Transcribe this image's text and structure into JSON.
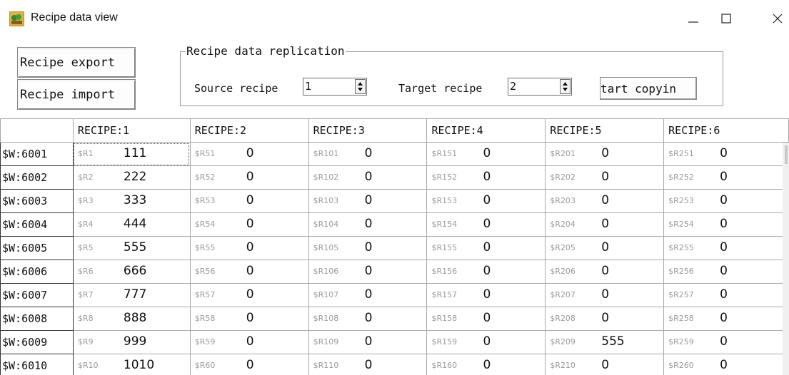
{
  "window": {
    "title": "Recipe data view",
    "minimize_glyph": "—",
    "maximize_glyph": "☐",
    "close_glyph": "✕"
  },
  "toolbar": {
    "export_label": "Recipe export",
    "import_label": "Recipe import"
  },
  "replication": {
    "group_title": "Recipe data replication",
    "source_label": "Source recipe",
    "source_value": "1",
    "target_label": "Target recipe",
    "target_value": "2",
    "copy_label": "tart copyin"
  },
  "grid": {
    "columns": [
      "RECIPE:1",
      "RECIPE:2",
      "RECIPE:3",
      "RECIPE:4",
      "RECIPE:5",
      "RECIPE:6"
    ],
    "rows": [
      {
        "header": "$W:6001",
        "cells": [
          [
            "$R1",
            "111"
          ],
          [
            "$R51",
            "0"
          ],
          [
            "$R101",
            "0"
          ],
          [
            "$R151",
            "0"
          ],
          [
            "$R201",
            "0"
          ],
          [
            "$R251",
            "0"
          ]
        ]
      },
      {
        "header": "$W:6002",
        "cells": [
          [
            "$R2",
            "222"
          ],
          [
            "$R52",
            "0"
          ],
          [
            "$R102",
            "0"
          ],
          [
            "$R152",
            "0"
          ],
          [
            "$R202",
            "0"
          ],
          [
            "$R252",
            "0"
          ]
        ]
      },
      {
        "header": "$W:6003",
        "cells": [
          [
            "$R3",
            "333"
          ],
          [
            "$R53",
            "0"
          ],
          [
            "$R103",
            "0"
          ],
          [
            "$R153",
            "0"
          ],
          [
            "$R203",
            "0"
          ],
          [
            "$R253",
            "0"
          ]
        ]
      },
      {
        "header": "$W:6004",
        "cells": [
          [
            "$R4",
            "444"
          ],
          [
            "$R54",
            "0"
          ],
          [
            "$R104",
            "0"
          ],
          [
            "$R154",
            "0"
          ],
          [
            "$R204",
            "0"
          ],
          [
            "$R254",
            "0"
          ]
        ]
      },
      {
        "header": "$W:6005",
        "cells": [
          [
            "$R5",
            "555"
          ],
          [
            "$R55",
            "0"
          ],
          [
            "$R105",
            "0"
          ],
          [
            "$R155",
            "0"
          ],
          [
            "$R205",
            "0"
          ],
          [
            "$R255",
            "0"
          ]
        ]
      },
      {
        "header": "$W:6006",
        "cells": [
          [
            "$R6",
            "666"
          ],
          [
            "$R56",
            "0"
          ],
          [
            "$R106",
            "0"
          ],
          [
            "$R156",
            "0"
          ],
          [
            "$R206",
            "0"
          ],
          [
            "$R256",
            "0"
          ]
        ]
      },
      {
        "header": "$W:6007",
        "cells": [
          [
            "$R7",
            "777"
          ],
          [
            "$R57",
            "0"
          ],
          [
            "$R107",
            "0"
          ],
          [
            "$R157",
            "0"
          ],
          [
            "$R207",
            "0"
          ],
          [
            "$R257",
            "0"
          ]
        ]
      },
      {
        "header": "$W:6008",
        "cells": [
          [
            "$R8",
            "888"
          ],
          [
            "$R58",
            "0"
          ],
          [
            "$R108",
            "0"
          ],
          [
            "$R158",
            "0"
          ],
          [
            "$R208",
            "0"
          ],
          [
            "$R258",
            "0"
          ]
        ]
      },
      {
        "header": "$W:6009",
        "cells": [
          [
            "$R9",
            "999"
          ],
          [
            "$R59",
            "0"
          ],
          [
            "$R109",
            "0"
          ],
          [
            "$R159",
            "0"
          ],
          [
            "$R209",
            "555"
          ],
          [
            "$R259",
            "0"
          ]
        ]
      },
      {
        "header": "$W:6010",
        "cells": [
          [
            "$R10",
            "1010"
          ],
          [
            "$R60",
            "0"
          ],
          [
            "$R110",
            "0"
          ],
          [
            "$R160",
            "0"
          ],
          [
            "$R210",
            "0"
          ],
          [
            "$R260",
            "0"
          ]
        ]
      }
    ]
  }
}
